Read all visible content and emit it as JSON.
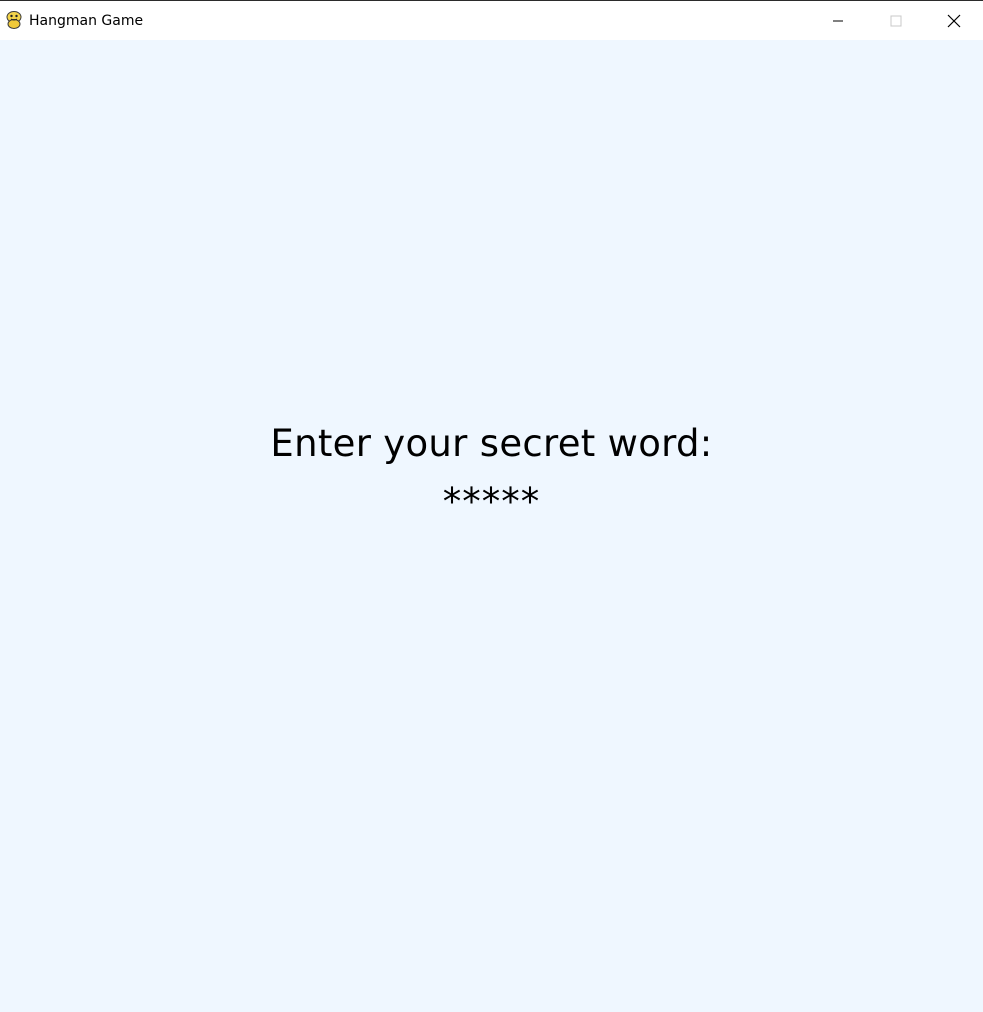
{
  "window": {
    "title": "Hangman Game",
    "icon": "python-snake-icon",
    "controls": {
      "minimize": "minimize-icon",
      "maximize": "maximize-icon",
      "close": "close-icon"
    }
  },
  "game": {
    "prompt": "Enter your secret word:",
    "masked_input": "*****"
  },
  "colors": {
    "background": "#eff7ff",
    "text": "#000000",
    "titlebar": "#ffffff"
  }
}
